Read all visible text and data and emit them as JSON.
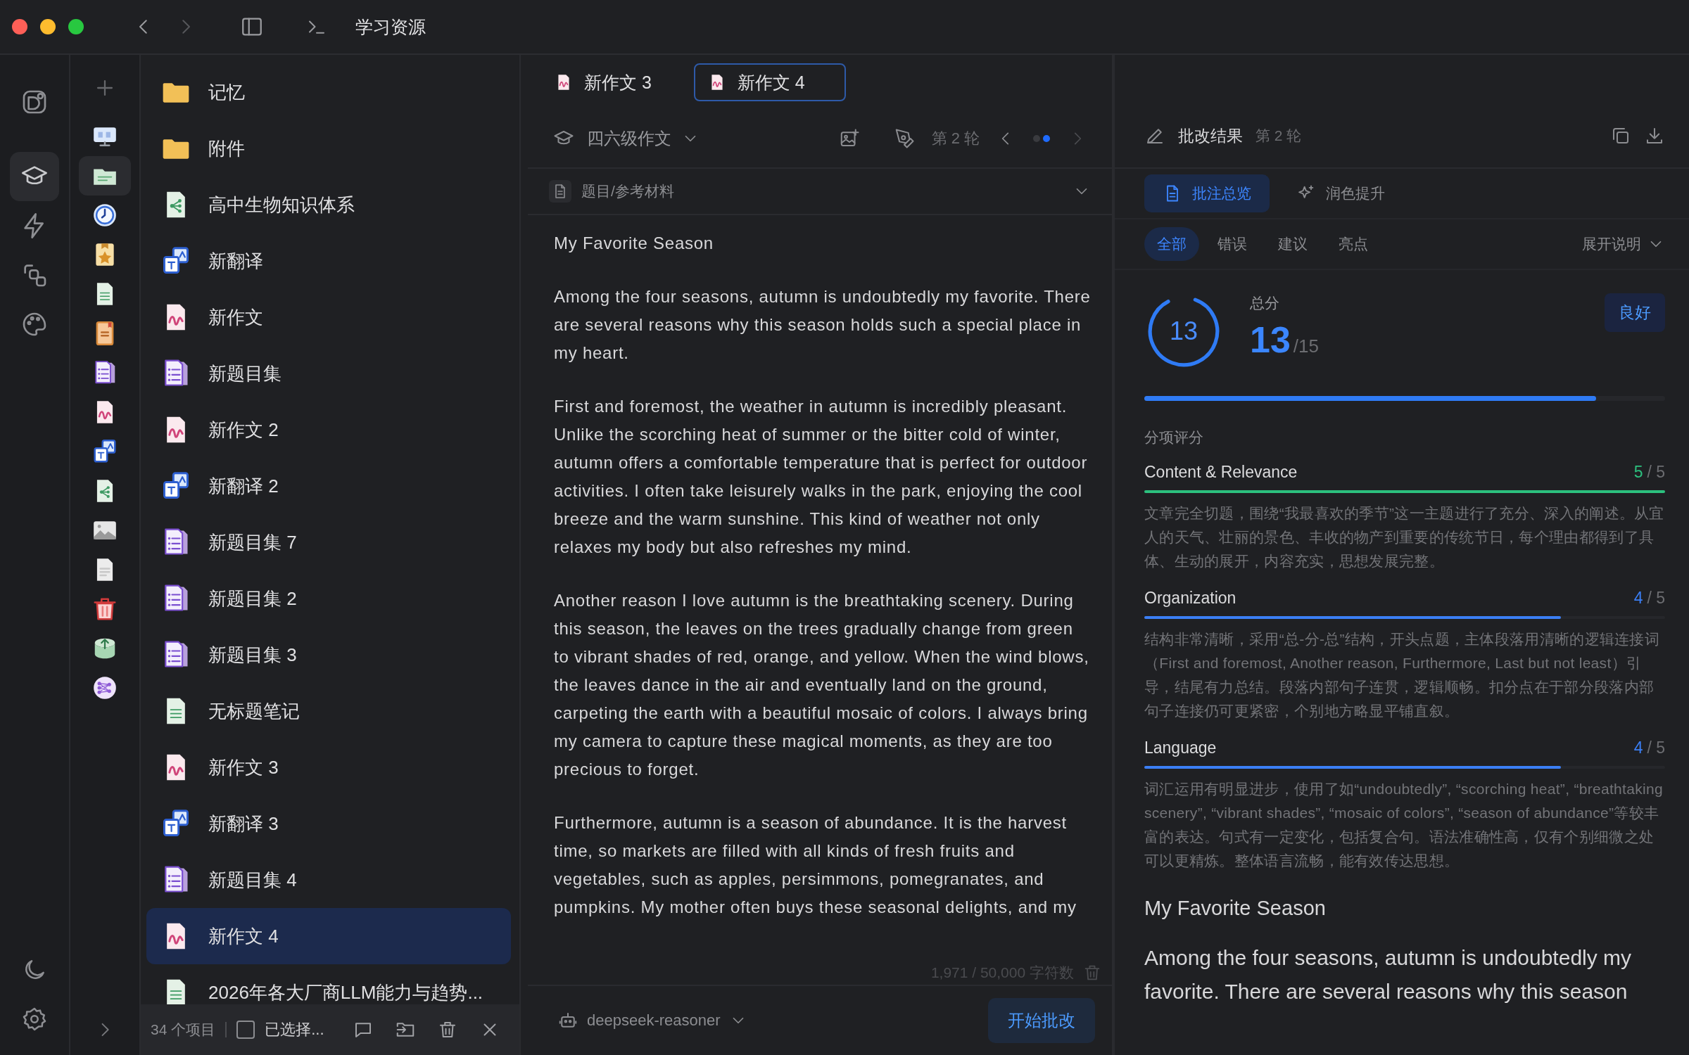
{
  "window": {
    "title": "学习资源"
  },
  "rail": {
    "top": [
      {
        "kind": "logo",
        "selected": false
      },
      {
        "kind": "cap",
        "selected": true
      },
      {
        "kind": "bolt",
        "selected": false
      },
      {
        "kind": "shapes",
        "selected": false
      },
      {
        "kind": "palette",
        "selected": false
      }
    ],
    "bottom": [
      {
        "kind": "moon"
      },
      {
        "kind": "gear"
      }
    ]
  },
  "icon_column": [
    {
      "kind": "board",
      "selected": false
    },
    {
      "kind": "greenfolder",
      "selected": true
    },
    {
      "kind": "clock",
      "selected": false
    },
    {
      "kind": "star",
      "selected": false
    },
    {
      "kind": "note",
      "selected": false
    },
    {
      "kind": "notebook",
      "selected": false
    },
    {
      "kind": "quiz",
      "selected": false
    },
    {
      "kind": "essay",
      "selected": false
    },
    {
      "kind": "translate",
      "selected": false
    },
    {
      "kind": "mindmap",
      "selected": false
    },
    {
      "kind": "image",
      "selected": false
    },
    {
      "kind": "blank",
      "selected": false
    },
    {
      "kind": "redtrash",
      "selected": false
    },
    {
      "kind": "dbup",
      "selected": false
    },
    {
      "kind": "graph",
      "selected": false
    }
  ],
  "files": {
    "items": [
      {
        "kind": "folder",
        "label": "记忆",
        "selected": false
      },
      {
        "kind": "folder",
        "label": "附件",
        "selected": false
      },
      {
        "kind": "mindmap",
        "label": "高中生物知识体系",
        "selected": false
      },
      {
        "kind": "translate",
        "label": "新翻译",
        "selected": false
      },
      {
        "kind": "essay",
        "label": "新作文",
        "selected": false
      },
      {
        "kind": "quiz",
        "label": "新题目集",
        "selected": false
      },
      {
        "kind": "essay",
        "label": "新作文 2",
        "selected": false
      },
      {
        "kind": "translate",
        "label": "新翻译 2",
        "selected": false
      },
      {
        "kind": "quiz",
        "label": "新题目集 7",
        "selected": false
      },
      {
        "kind": "quiz",
        "label": "新题目集 2",
        "selected": false
      },
      {
        "kind": "quiz",
        "label": "新题目集 3",
        "selected": false
      },
      {
        "kind": "note",
        "label": "无标题笔记",
        "selected": false
      },
      {
        "kind": "essay",
        "label": "新作文 3",
        "selected": false
      },
      {
        "kind": "translate",
        "label": "新翻译 3",
        "selected": false
      },
      {
        "kind": "quiz",
        "label": "新题目集 4",
        "selected": false
      },
      {
        "kind": "essay",
        "label": "新作文 4",
        "selected": true
      },
      {
        "kind": "note",
        "label": "2026年各大厂商LLM能力与趋势...",
        "selected": false
      }
    ],
    "footer": {
      "count": "34 个项目",
      "select": {
        "label": "已选择...",
        "checked": false
      }
    }
  },
  "editor": {
    "tabs": [
      {
        "label": "新作文 3",
        "selected": false
      },
      {
        "label": "新作文 4",
        "selected": true
      }
    ],
    "toolbar": {
      "type": "四六级作文",
      "round": "第 2 轮",
      "pages": [
        {
          "selected": false
        },
        {
          "selected": true
        }
      ]
    },
    "reference": "题目/参考材料",
    "essay": {
      "title": "My Favorite Season",
      "paragraphs": [
        "Among the four seasons, autumn is undoubtedly my favorite. There are several reasons why this season holds such a special place in my heart.",
        "First and foremost, the weather in autumn is incredibly pleasant. Unlike the scorching heat of summer or the bitter cold of winter, autumn offers a comfortable temperature that is perfect for outdoor activities. I often take leisurely walks in the park, enjoying the cool breeze and the warm sunshine. This kind of weather not only relaxes my body but also refreshes my mind.",
        "Another reason I love autumn is the breathtaking scenery. During this season, the leaves on the trees gradually change from green to vibrant shades of red, orange, and yellow. When the wind blows, the leaves dance in the air and eventually land on the ground, carpeting the earth with a beautiful mosaic of colors. I always bring my camera to capture these magical moments, as they are too precious to forget.",
        "Furthermore, autumn is a season of abundance. It is the harvest time, so markets are filled with all kinds of fresh fruits and vegetables, such as apples, persimmons, pomegranates, and pumpkins. My mother often buys these seasonal delights, and my"
      ]
    },
    "char_count": "1,971 / 50,000 字符数",
    "model": "deepseek-reasoner",
    "submit": "开始批改"
  },
  "result": {
    "title": "批改结果",
    "round": "第 2 轮",
    "views": [
      {
        "kind": "doc",
        "label": "批注总览",
        "selected": true
      },
      {
        "kind": "sparkle",
        "label": "润色提升",
        "selected": false
      }
    ],
    "filters": [
      {
        "label": "全部",
        "selected": true
      },
      {
        "label": "错误",
        "selected": false
      },
      {
        "label": "建议",
        "selected": false
      },
      {
        "label": "亮点",
        "selected": false
      }
    ],
    "expand": "展开说明",
    "score": {
      "ring_value": "13",
      "label": "总分",
      "value": "13",
      "max": "/15",
      "level": 0.867,
      "grade": "良好"
    },
    "section": "分项评分",
    "criteria": [
      {
        "name": "Content & Relevance",
        "score": "5",
        "max": "/ 5",
        "level": 1,
        "color": "#2cc07e",
        "comment": "文章完全切题，围绕“我最喜欢的季节”这一主题进行了充分、深入的阐述。从宜人的天气、壮丽的景色、丰收的物产到重要的传统节日，每个理由都得到了具体、生动的展开，内容充实，思想发展完整。"
      },
      {
        "name": "Organization",
        "score": "4",
        "max": "/ 5",
        "level": 0.8,
        "color": "#3b7ff5",
        "comment": "结构非常清晰，采用“总-分-总”结构，开头点题，主体段落用清晰的逻辑连接词（First and foremost, Another reason, Furthermore, Last but not least）引导，结尾有力总结。段落内部句子连贯，逻辑顺畅。扣分点在于部分段落内部句子连接仍可更紧密，个别地方略显平铺直叙。"
      },
      {
        "name": "Language",
        "score": "4",
        "max": "/ 5",
        "level": 0.8,
        "color": "#3b7ff5",
        "comment": "词汇运用有明显进步，使用了如“undoubtedly”, “scorching heat”, “breathtaking scenery”, “vibrant shades”, “mosaic of colors”, “season of abundance”等较丰富的表达。句式有一定变化，包括复合句。语法准确性高，仅有个别细微之处可以更精炼。整体语言流畅，能有效传达思想。"
      }
    ],
    "preview": {
      "title": "My Favorite Season",
      "text": "Among the four seasons, autumn is undoubtedly my favorite. There are several reasons why this season"
    }
  }
}
